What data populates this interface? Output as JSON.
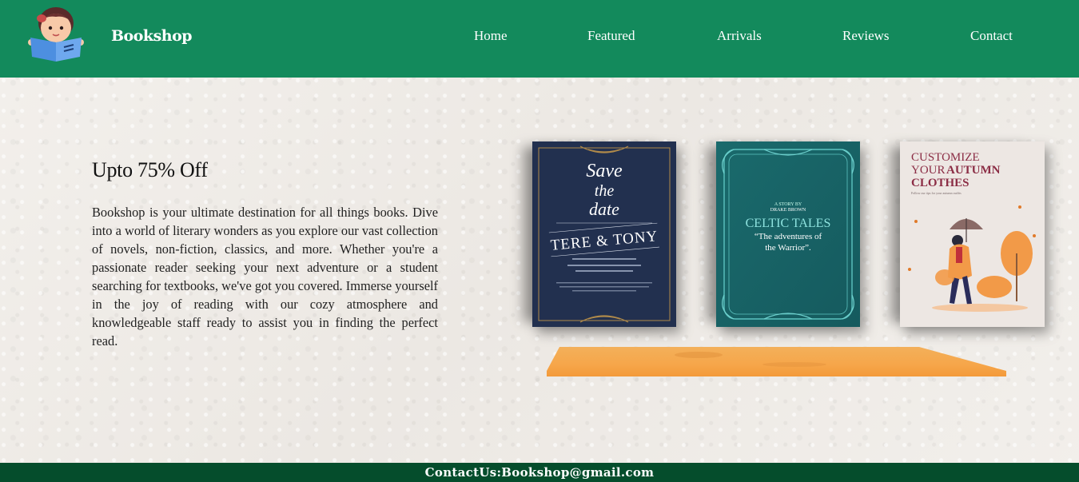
{
  "header": {
    "brand": "Bookshop",
    "nav": [
      "Home",
      "Featured",
      "Arrivals",
      "Reviews",
      "Contact"
    ]
  },
  "hero": {
    "title": "Upto 75% Off",
    "description": "Bookshop is your ultimate destination for all things books. Dive into a world of literary wonders as you explore our vast collection of novels, non-fiction, classics, and more. Whether you're a passionate reader seeking your next adventure or a student searching for textbooks, we've got you covered. Immerse yourself in the joy of reading with our cozy atmosphere and knowledgeable staff ready to assist you in finding the perfect read."
  },
  "books": [
    {
      "script_lines": [
        "Save",
        "the",
        "date"
      ],
      "title": "TERE & TONY"
    },
    {
      "byline_small": "A STORY BY",
      "author": "DRAKE BROWN",
      "title": "CELTIC TALES",
      "subtitle_line1": "“The adventures of",
      "subtitle_line2": "the Warrior”."
    },
    {
      "title_line1": "CUSTOMIZE",
      "title_line2_a": "YOUR",
      "title_line2_b": "AUTUMN",
      "title_line3": "CLOTHES",
      "subtitle": "Follow our tips for your autumn outfits"
    }
  ],
  "footer": {
    "contact": "ContactUs:Bookshop@gmail.com"
  },
  "colors": {
    "header": "#138a5c",
    "footer": "#054d2c",
    "shelf": "#f5a34a"
  }
}
